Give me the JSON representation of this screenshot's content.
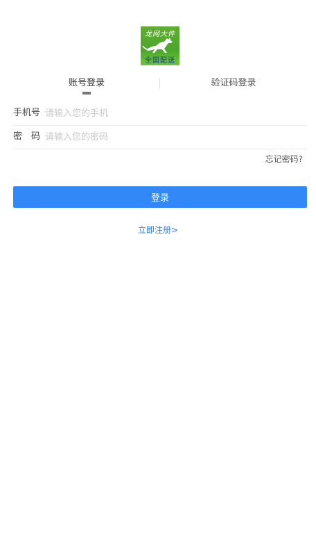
{
  "logo": {
    "text_top": "龙网大件",
    "text_bottom": "全国配送",
    "colors": {
      "background": "#5fae2f",
      "horse": "#ffffff"
    }
  },
  "tabs": [
    {
      "label": "账号登录",
      "active": true
    },
    {
      "label": "验证码登录",
      "active": false
    }
  ],
  "form": {
    "phone": {
      "label": "手机号",
      "placeholder": "请输入您的手机",
      "value": ""
    },
    "password": {
      "label": "密　码",
      "placeholder": "请输入您的密码",
      "value": ""
    },
    "forgot_label": "忘记密码?",
    "login_label": "登录"
  },
  "register_label": "立即注册>",
  "colors": {
    "accent": "#3388f7",
    "link": "#2f7fe0",
    "text": "#333333",
    "placeholder": "#c8c8c8",
    "divider": "#ececec"
  }
}
